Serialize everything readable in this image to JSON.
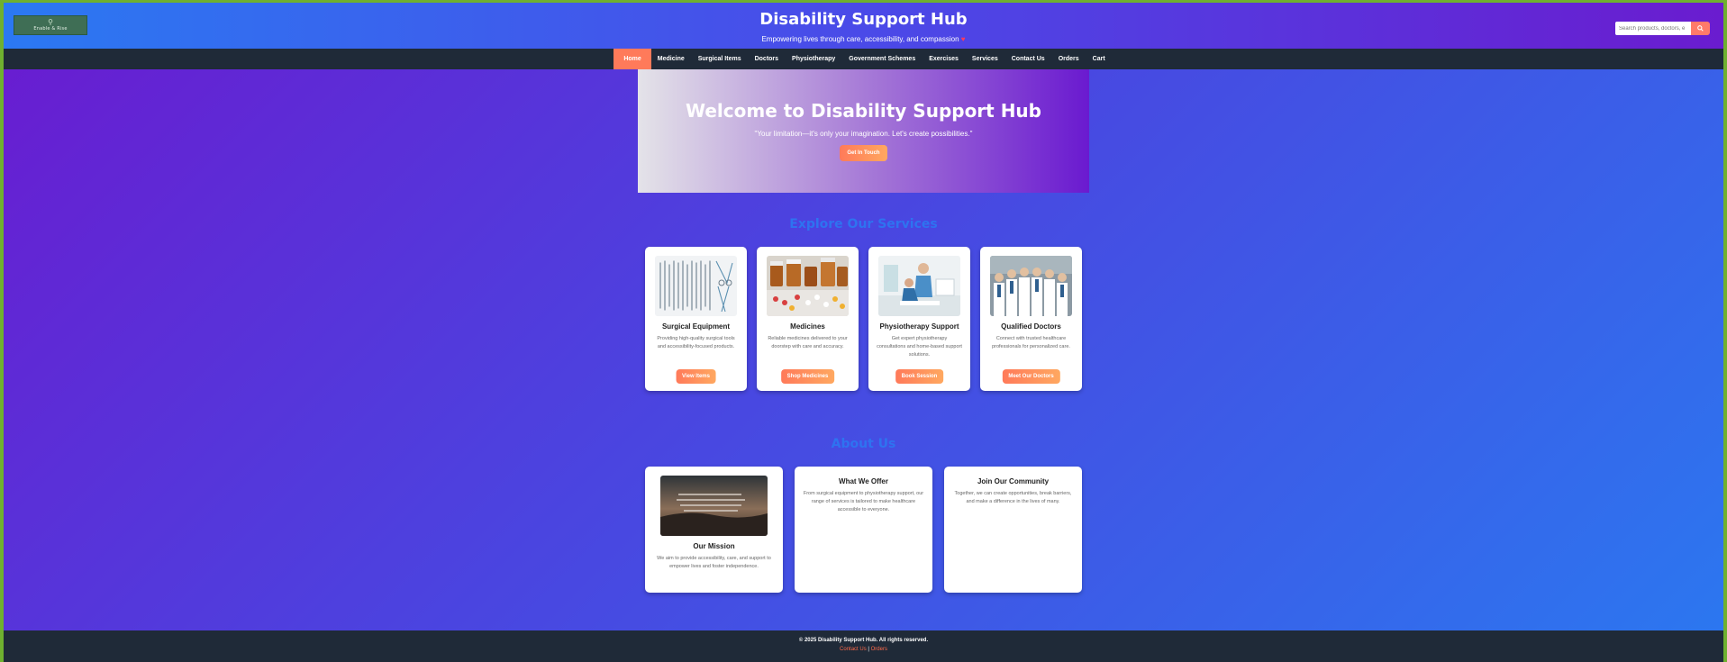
{
  "header": {
    "logo_text": "Enable & Rise",
    "title": "Disability Support Hub",
    "tagline": "Empowering lives through care, accessibility, and compassion",
    "heart_icon": "heart-icon",
    "search_placeholder": "Search products, doctors, e",
    "search_icon": "search-icon"
  },
  "nav": {
    "items": [
      "Home",
      "Medicine",
      "Surgical Items",
      "Doctors",
      "Physiotherapy",
      "Government Schemes",
      "Exercises",
      "Services",
      "Contact Us",
      "Orders",
      "Cart"
    ],
    "active": "Home"
  },
  "hero": {
    "title": "Welcome to Disability Support Hub",
    "quote": "\"Your limitation—it's only your imagination. Let's create possibilities.\"",
    "button": "Get In Touch"
  },
  "services": {
    "title": "Explore Our Services",
    "cards": [
      {
        "title": "Surgical Equipment",
        "desc": "Providing high-quality surgical tools and accessibility-focused products.",
        "button": "View Items"
      },
      {
        "title": "Medicines",
        "desc": "Reliable medicines delivered to your doorstep with care and accuracy.",
        "button": "Shop Medicines"
      },
      {
        "title": "Physiotherapy Support",
        "desc": "Get expert physiotherapy consultations and home-based support solutions.",
        "button": "Book Session"
      },
      {
        "title": "Qualified Doctors",
        "desc": "Connect with trusted healthcare professionals for personalized care.",
        "button": "Meet Our Doctors"
      }
    ]
  },
  "about": {
    "title": "About Us",
    "cards": [
      {
        "title": "Our Mission",
        "desc": "We aim to provide accessibility, care, and support to empower lives and foster independence."
      },
      {
        "title": "What We Offer",
        "desc": "From surgical equipment to physiotherapy support, our range of services is tailored to make healthcare accessible to everyone."
      },
      {
        "title": "Join Our Community",
        "desc": "Together, we can create opportunities, break barriers, and make a difference in the lives of many."
      }
    ]
  },
  "footer": {
    "copyright": "© 2025 Disability Support Hub. All rights reserved.",
    "link_contact": "Contact Us",
    "separator": "|",
    "link_orders": "Orders"
  },
  "colors": {
    "accent": "#ff7a5a",
    "nav_bg": "#1f2a38",
    "section_title": "#2e73f0"
  }
}
